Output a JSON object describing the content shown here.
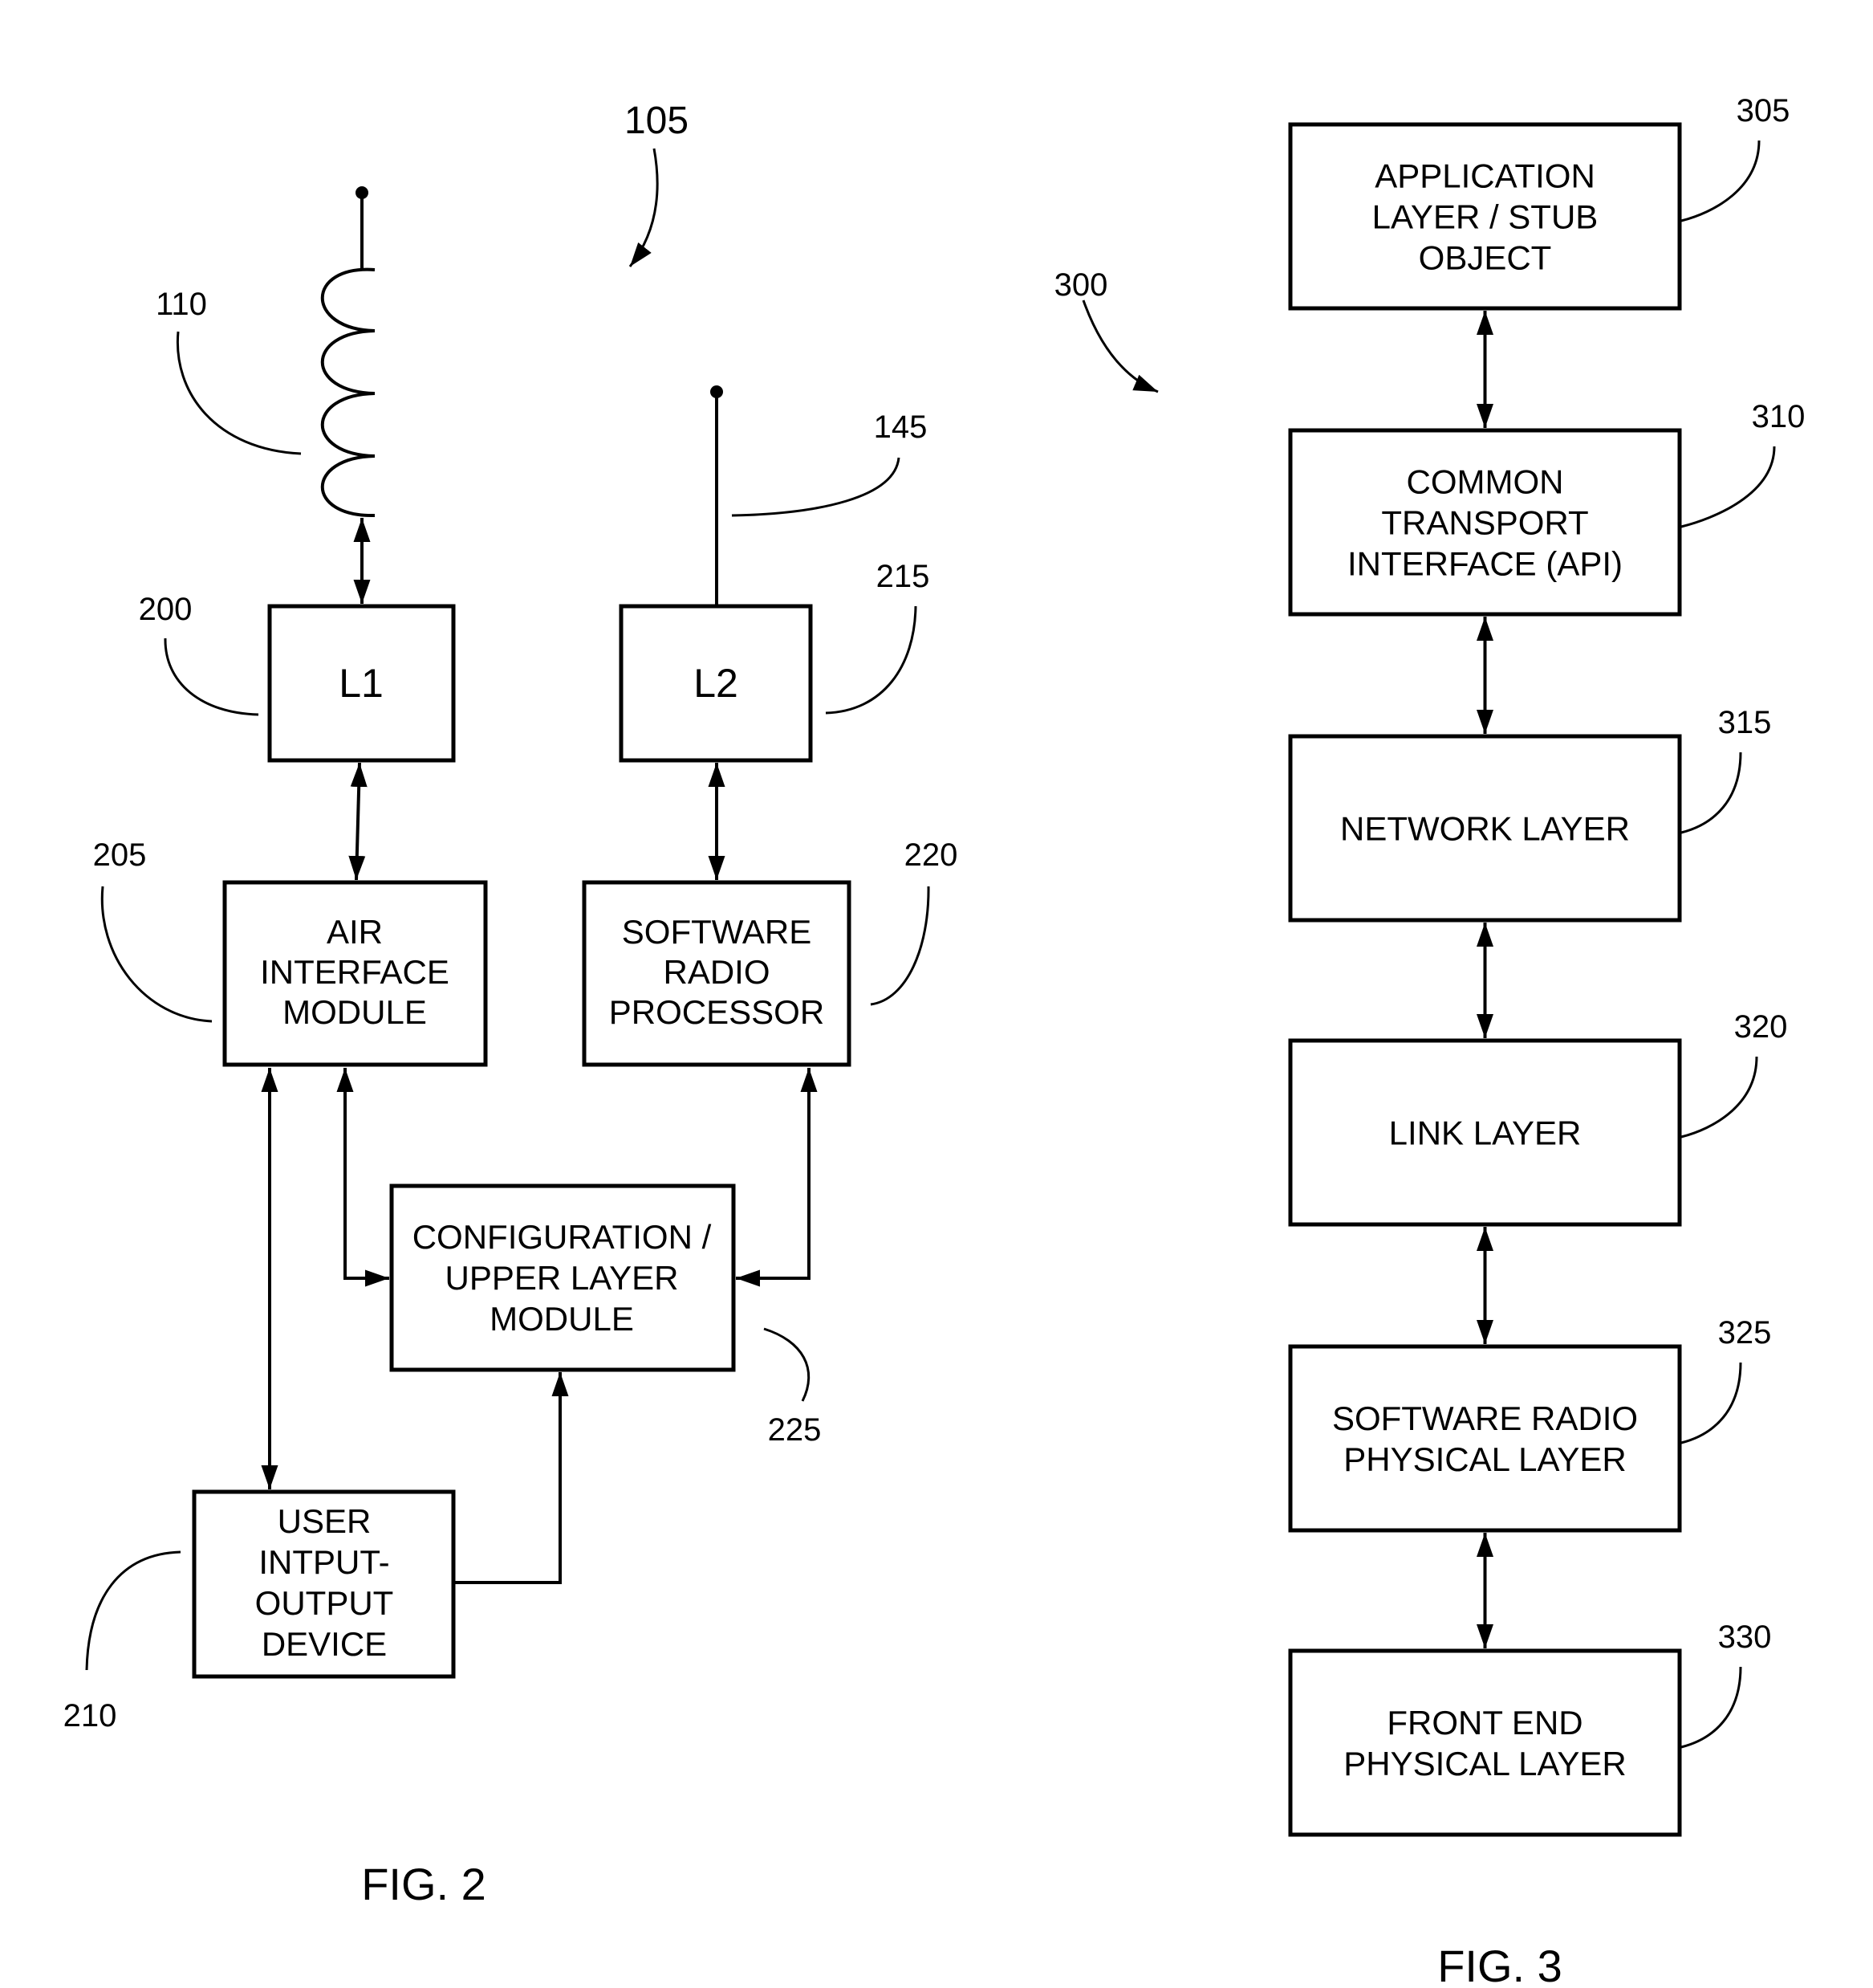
{
  "fig2": {
    "caption": "FIG. 2",
    "device_ref": "105",
    "antenna_coil_ref": "110",
    "antenna_whip_ref": "145",
    "blocks": {
      "l1": {
        "ref": "200",
        "lines": [
          "L1"
        ]
      },
      "l2": {
        "ref": "215",
        "lines": [
          "L2"
        ]
      },
      "air_interface": {
        "ref": "205",
        "lines": [
          "AIR",
          "INTERFACE",
          "MODULE"
        ]
      },
      "software_radio_processor": {
        "ref": "220",
        "lines": [
          "SOFTWARE",
          "RADIO",
          "PROCESSOR"
        ]
      },
      "configuration": {
        "ref": "225",
        "lines": [
          "CONFIGURATION /",
          "UPPER LAYER",
          "MODULE"
        ]
      },
      "user_io": {
        "ref": "210",
        "lines": [
          "USER",
          "INTPUT-",
          "OUTPUT",
          "DEVICE"
        ]
      }
    }
  },
  "fig3": {
    "caption": "FIG. 3",
    "stack_ref": "300",
    "layers": [
      {
        "ref": "305",
        "lines": [
          "APPLICATION",
          "LAYER / STUB",
          "OBJECT"
        ]
      },
      {
        "ref": "310",
        "lines": [
          "COMMON",
          "TRANSPORT",
          "INTERFACE (API)"
        ]
      },
      {
        "ref": "315",
        "lines": [
          "NETWORK LAYER"
        ]
      },
      {
        "ref": "320",
        "lines": [
          "LINK LAYER"
        ]
      },
      {
        "ref": "325",
        "lines": [
          "SOFTWARE RADIO",
          "PHYSICAL LAYER"
        ]
      },
      {
        "ref": "330",
        "lines": [
          "FRONT END",
          "PHYSICAL LAYER"
        ]
      }
    ]
  }
}
